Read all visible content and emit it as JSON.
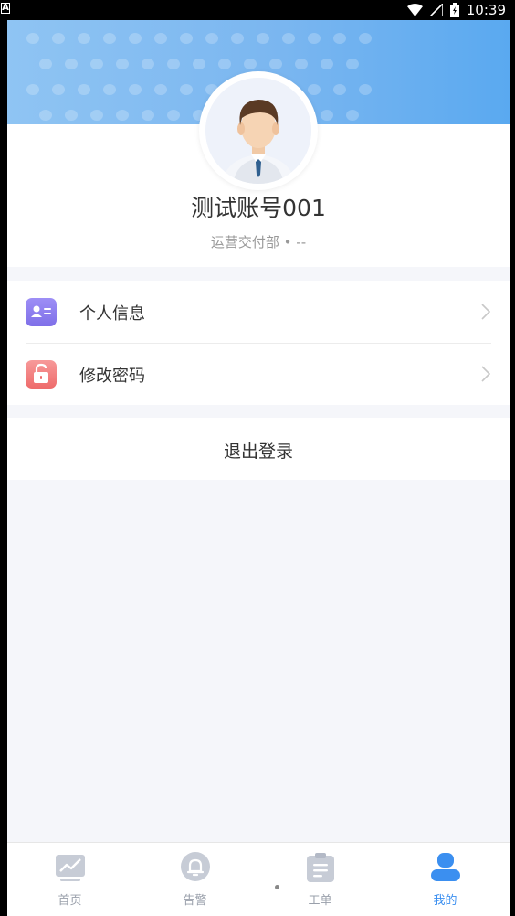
{
  "status_bar": {
    "notification_glyph": "A",
    "time": "10:39"
  },
  "user": {
    "name": "测试账号001",
    "department": "运营交付部 • --"
  },
  "menu": {
    "items": [
      {
        "label": "个人信息",
        "icon": "id-card-icon",
        "color": "#8a7cf0"
      },
      {
        "label": "修改密码",
        "icon": "lock-icon",
        "color": "#f07878"
      }
    ]
  },
  "logout_label": "退出登录",
  "tabbar": {
    "tabs": [
      {
        "label": "首页",
        "icon": "chart-icon"
      },
      {
        "label": "告警",
        "icon": "bell-icon"
      },
      {
        "label": "工单",
        "icon": "clipboard-icon"
      },
      {
        "label": "我的",
        "icon": "user-icon"
      }
    ],
    "active_color": "#3b8ff0",
    "inactive_color": "#c7ccd6"
  }
}
